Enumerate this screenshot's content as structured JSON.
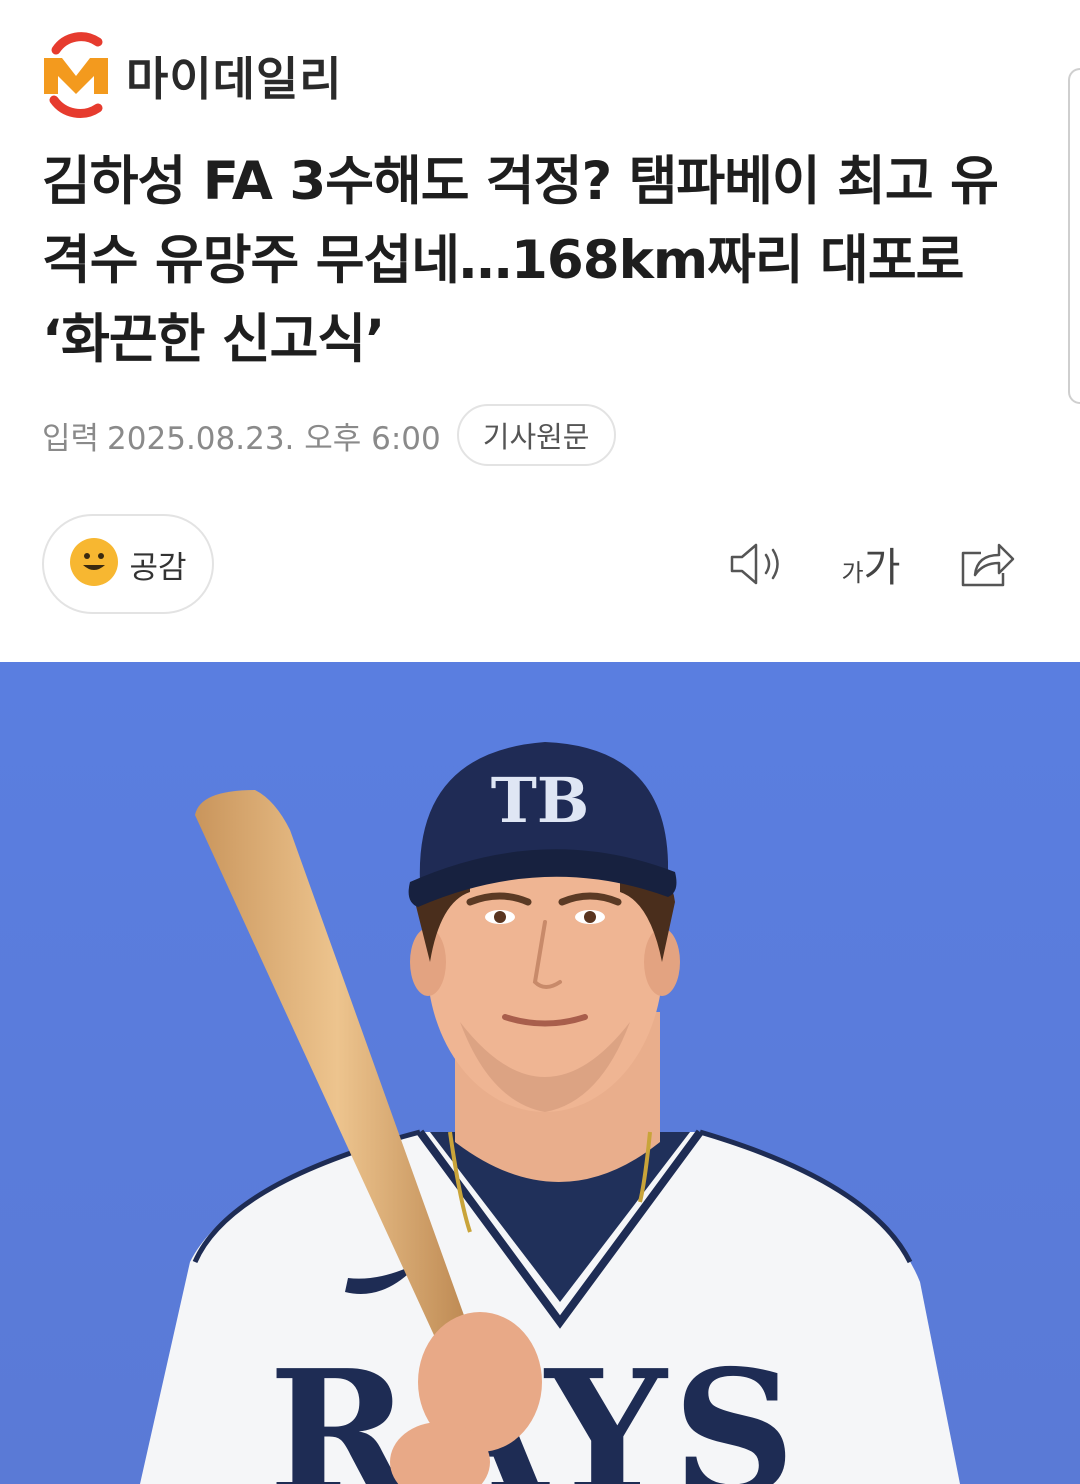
{
  "header": {
    "brand_name": "마이데일리",
    "logo_icon": "mydaily-m-logo"
  },
  "article": {
    "headline": "김하성 FA 3수해도 걱정? 탬파베이 최고 유격수 유망주 무섭네…168km짜리 대포로 ‘화끈한 신고식’",
    "date_label": "입력",
    "date_value": "2025.08.23. 오후 6:00",
    "source_button": "기사원문"
  },
  "actions": {
    "empathy_label": "공감",
    "empathy_icon": "smiley-icon",
    "tts_icon": "speaker-icon",
    "font_size_icon": {
      "small": "가",
      "large": "가"
    },
    "share_icon": "share-icon"
  },
  "photo": {
    "cap_logo": "TB",
    "jersey_text": "RAYS",
    "background_color": "#5b7fd9"
  },
  "colors": {
    "brand_orange": "#f39a1e",
    "brand_red": "#e63b2e",
    "background": "#ffffff",
    "text": "#1e1e1e",
    "muted": "#8a8a8a"
  }
}
